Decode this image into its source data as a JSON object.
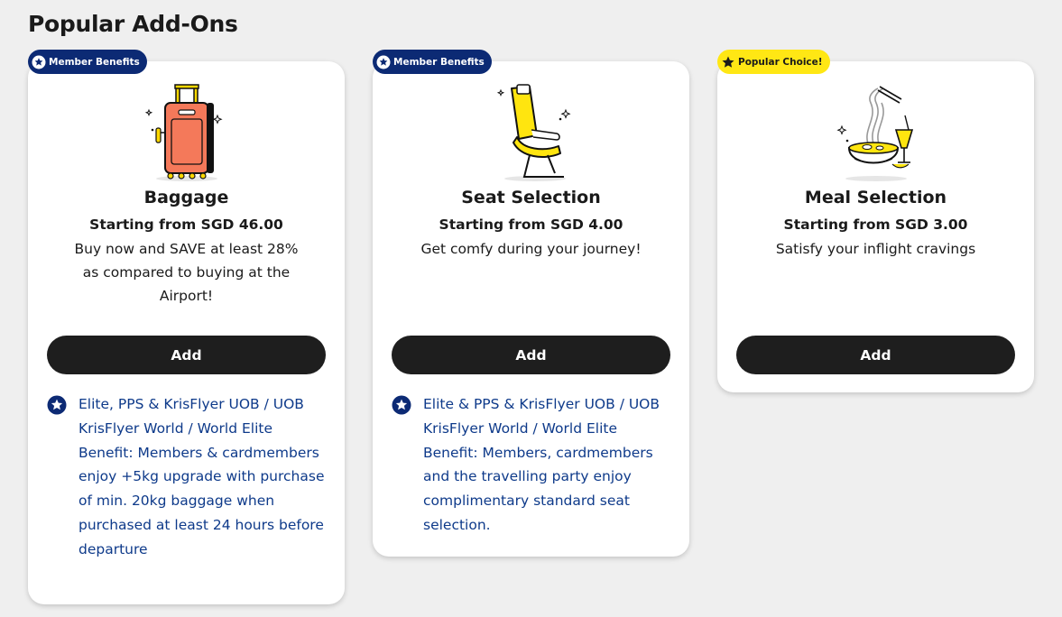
{
  "page": {
    "title": "Popular Add-Ons"
  },
  "colors": {
    "background": "#efefef",
    "member_badge": "#0c2a74",
    "popular_badge": "#ffe714",
    "button": "#1e1e1e",
    "benefit_text": "#0e3a8a",
    "baggage": "#f4795a",
    "seat": "#ffe50f"
  },
  "cards": [
    {
      "badge": {
        "label": "Member Benefits",
        "icon": "star-circle-icon"
      },
      "illustration": "suitcase-icon",
      "title": "Baggage",
      "price": "Starting from SGD 46.00",
      "description": "Buy now and SAVE at least 28% as compared to buying at the Airport!",
      "button": "Add",
      "benefit": "Elite, PPS & KrisFlyer UOB / UOB KrisFlyer World / World Elite Benefit: Members & cardmembers enjoy +5kg upgrade with purchase of min. 20kg baggage when purchased at least 24 hours before departure"
    },
    {
      "badge": {
        "label": "Member Benefits",
        "icon": "star-circle-icon"
      },
      "illustration": "seat-icon",
      "title": "Seat Selection",
      "price": "Starting from SGD 4.00",
      "description": "Get comfy during your journey!",
      "button": "Add",
      "benefit": "Elite & PPS & KrisFlyer UOB / UOB KrisFlyer World / World Elite Benefit: Members, cardmembers and the travelling party enjoy complimentary standard seat selection."
    },
    {
      "badge": {
        "label": "Popular Choice!",
        "icon": "star-icon"
      },
      "illustration": "noodle-bowl-icon",
      "title": "Meal Selection",
      "price": "Starting from SGD 3.00",
      "description": "Satisfy your inflight cravings",
      "button": "Add"
    }
  ]
}
